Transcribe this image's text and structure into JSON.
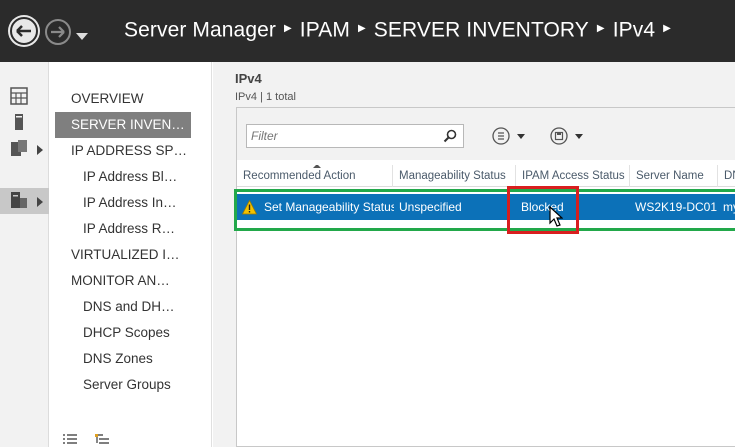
{
  "titlebar": {
    "breadcrumbs": [
      "Server Manager",
      "IPAM",
      "SERVER INVENTORY",
      "IPv4"
    ]
  },
  "icons": {
    "back": "back-arrow-icon",
    "forward": "forward-arrow-icon",
    "dropdown": "chevron-down-icon"
  },
  "tree": {
    "items": [
      {
        "label": "OVERVIEW",
        "selected": false
      },
      {
        "label": "SERVER INVEN…",
        "selected": true
      },
      {
        "label": "IP ADDRESS SP…",
        "selected": false
      },
      {
        "label": "IP Address Bl…",
        "selected": false
      },
      {
        "label": "IP Address In…",
        "selected": false
      },
      {
        "label": "IP Address R…",
        "selected": false
      },
      {
        "label": "VIRTUALIZED I…",
        "selected": false
      },
      {
        "label": "MONITOR AN…",
        "selected": false
      },
      {
        "label": "DNS and DH…",
        "selected": false
      },
      {
        "label": "DHCP Scopes",
        "selected": false
      },
      {
        "label": "DNS Zones",
        "selected": false
      },
      {
        "label": "Server Groups",
        "selected": false
      }
    ]
  },
  "main": {
    "title": "IPv4",
    "subtitle": "IPv4 | 1 total",
    "filter_placeholder": "Filter",
    "columns": [
      "Recommended Action",
      "Manageability Status",
      "IPAM Access Status",
      "Server Name",
      "DN"
    ],
    "rows": [
      {
        "recommended_action": "Set Manageability Status",
        "manageability_status": "Unspecified",
        "ipam_access_status": "Blocked",
        "server_name": "WS2K19-DC01",
        "dns": "my"
      }
    ]
  },
  "colors": {
    "titlebar_bg": "#2b2b2b",
    "selected_row": "#0c71b8",
    "highlight_green": "#22a84a",
    "highlight_red": "#d81f1f",
    "warning": "#f2c200"
  }
}
